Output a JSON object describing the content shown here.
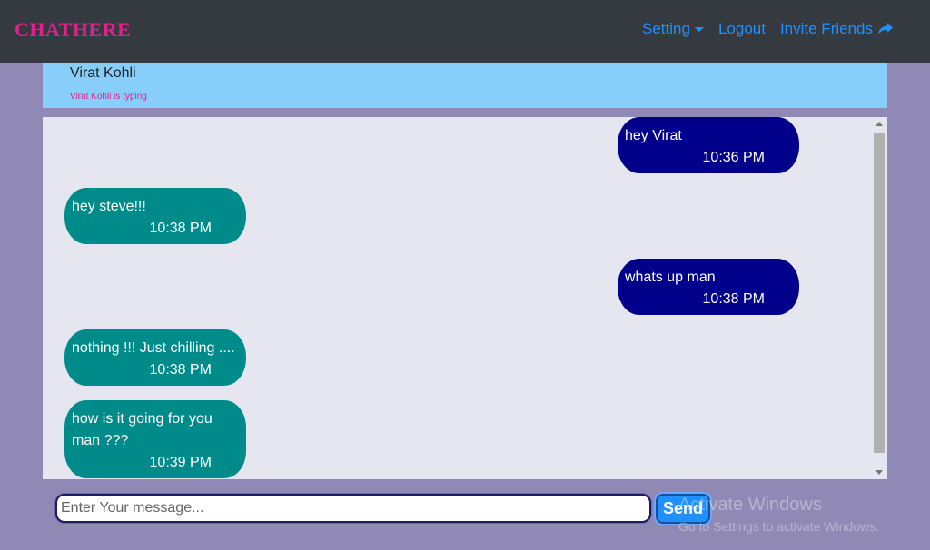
{
  "navbar": {
    "brand": "CHATHERE",
    "links": {
      "setting": "Setting",
      "logout": "Logout",
      "invite": "Invite Friends"
    }
  },
  "chat_header": {
    "contact_name": "Virat Kohli",
    "typing_status": "Virat Kohli is typing"
  },
  "messages": [
    {
      "direction": "sent",
      "text": "hey Virat",
      "time": "10:36 PM"
    },
    {
      "direction": "received",
      "text": "hey steve!!!",
      "time": "10:38 PM"
    },
    {
      "direction": "sent",
      "text": "whats up man",
      "time": "10:38 PM"
    },
    {
      "direction": "received",
      "text": "nothing !!! Just chilling ....",
      "time": "10:38 PM"
    },
    {
      "direction": "received",
      "text": "how is it going for you man ???",
      "time": "10:39 PM"
    }
  ],
  "composer": {
    "placeholder": "Enter Your message...",
    "value": "",
    "send_label": "Send"
  },
  "watermark": {
    "title": "Activate Windows",
    "subtitle": "Go to Settings to activate Windows."
  },
  "colors": {
    "navbar_bg": "#343a40",
    "brand": "#e0218a",
    "link": "#1e90ff",
    "header_bg": "#87cefa",
    "page_bg": "#9189b5",
    "sent_bubble": "#00008b",
    "received_bubble": "#008b8b",
    "send_button": "#1e90ff"
  },
  "icons": {
    "setting_dropdown": "caret-down-icon",
    "invite": "share-icon"
  }
}
